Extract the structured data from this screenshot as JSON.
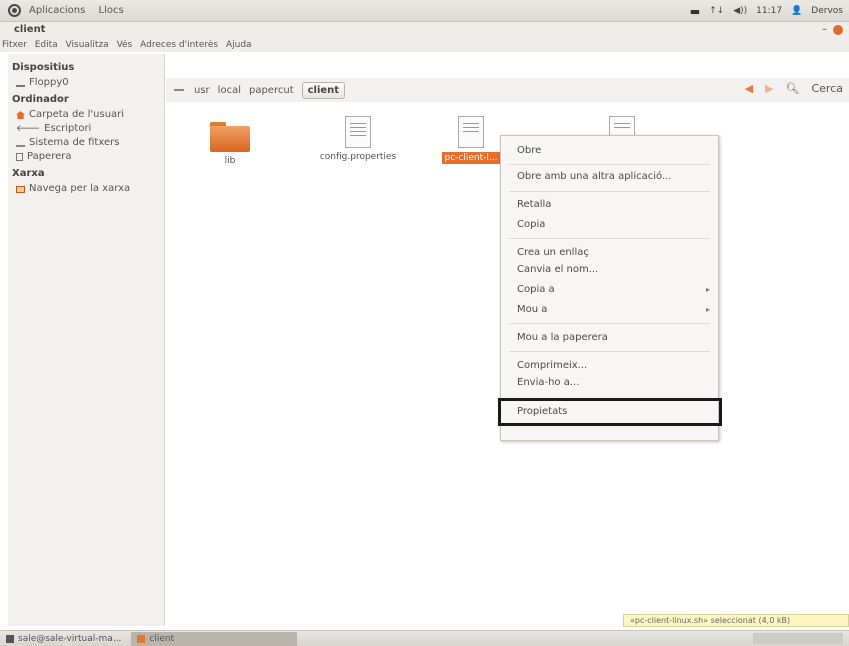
{
  "top_panel": {
    "app_menu": "Aplicacions",
    "places_menu": "Llocs",
    "clock": "11:17",
    "user": "Dervos",
    "tray_transfer": "↑↓",
    "tray_volume": "◀))"
  },
  "window": {
    "title": "client",
    "menus": [
      "Fitxer",
      "Edita",
      "Visualitza",
      "Vés",
      "Adreces d'interès",
      "Ajuda"
    ]
  },
  "sidebar": {
    "sections": [
      {
        "heading": "Dispositius",
        "items": [
          "Floppy0"
        ]
      },
      {
        "heading": "Ordinador",
        "items": [
          "Carpeta de l'usuari",
          "Escriptori",
          "Sistema de fitxers",
          "Paperera"
        ]
      },
      {
        "heading": "Xarxa",
        "items": [
          "Navega per la xarxa"
        ]
      }
    ]
  },
  "location": {
    "crumbs": [
      "usr",
      "local",
      "papercut",
      "client"
    ],
    "search_label": "Cerca"
  },
  "files": [
    {
      "name": "lib",
      "type": "folder"
    },
    {
      "name": "config.properties",
      "type": "doc"
    },
    {
      "name": "pc-client-l...",
      "type": "doc",
      "selected": true
    },
    {
      "name": "",
      "type": "doc"
    }
  ],
  "context_menu": {
    "items": [
      {
        "label": "Obre"
      },
      {
        "label": "Obre amb una altra aplicació..."
      },
      {
        "label": "Retalla"
      },
      {
        "label": "Copia"
      },
      {
        "label": "Crea un enllaç"
      },
      {
        "label": "Canvia el nom..."
      },
      {
        "label": "Copia a",
        "submenu": true
      },
      {
        "label": "Mou a",
        "submenu": true
      },
      {
        "label": "Mou a la paperera"
      },
      {
        "label": "Comprimeix..."
      },
      {
        "label": "Envia-ho a..."
      },
      {
        "label": "Propietats",
        "highlighted": true
      }
    ]
  },
  "status": {
    "text": "«pc-client-linux.sh» seleccionat (4,0 kB)"
  },
  "taskbar": {
    "tasks": [
      "sale@sale-virtual-ma...",
      "client"
    ]
  },
  "colors": {
    "accent": "#e96d2b",
    "folder": "#e2782f",
    "highlight_box": "#1a1a1a"
  }
}
